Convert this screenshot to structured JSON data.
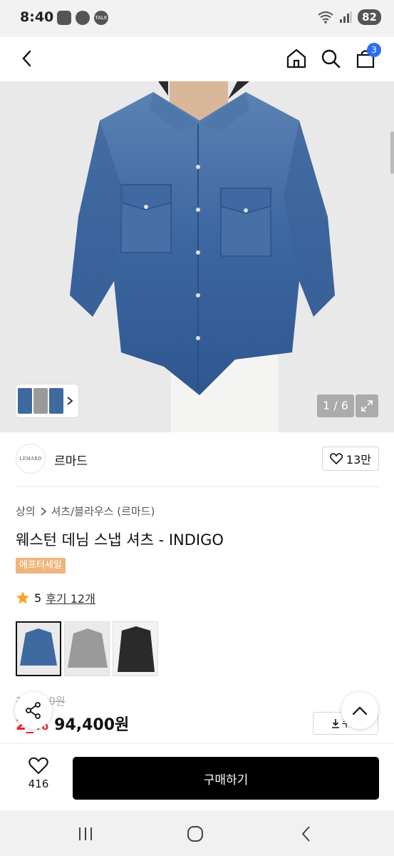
{
  "status": {
    "time": "8:40",
    "talk_badge": "TALK",
    "battery": "82"
  },
  "nav": {
    "cart_count": "3"
  },
  "gallery": {
    "counter": "1 / 6"
  },
  "brand": {
    "logo_text": "LEMARD",
    "name": "르마드",
    "likes": "13만"
  },
  "breadcrumb": {
    "category": "상의",
    "subcategory": "셔츠/블라우스 (르마드)"
  },
  "product": {
    "title": "웨스턴 데님 스냅 셔츠 - INDIGO",
    "tag": "애프터세일",
    "rating": "5",
    "reviews": "후기 12개",
    "original_price": "1__,_00원",
    "discount": "2_%",
    "sale_price": "94,400원",
    "coupon_label": "쿠폰"
  },
  "colors": [
    "#3e6aa0",
    "#9a9a9a",
    "#2a2a2a"
  ],
  "actions": {
    "wish_count": "416",
    "buy_label": "구매하기"
  }
}
